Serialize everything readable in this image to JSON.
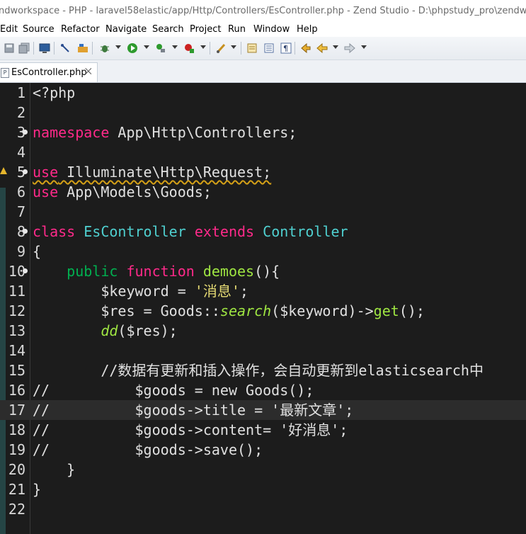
{
  "window": {
    "title": "ndworkspace - PHP - laravel58elastic/app/Http/Controllers/EsController.php - Zend Studio - D:\\phpstudy_pro\\zendworkspace"
  },
  "menu": [
    "Edit",
    "Source",
    "Refactor",
    "Navigate",
    "Search",
    "Project",
    "Run",
    "Window",
    "Help"
  ],
  "toolbar": {
    "icons": [
      "save-icon",
      "save-all-icon",
      "console-icon",
      "debug-toggle-icon",
      "build-icon",
      "bug-icon",
      "run-icon",
      "external-tools-icon",
      "coverage-icon",
      "brush-icon",
      "annotate-icon",
      "outline-icon",
      "paragraph-icon",
      "last-edit-icon",
      "back-icon",
      "forward-icon"
    ]
  },
  "editor_tab": {
    "label": "EsController.php",
    "close": "⨉"
  },
  "code_lines": [
    {
      "n": "1",
      "html": "&lt;?php"
    },
    {
      "n": "2",
      "html": ""
    },
    {
      "n": "3",
      "fold": true,
      "html": "<span class=\"k\">namespace</span> App\\Http\\Controllers;"
    },
    {
      "n": "4",
      "html": ""
    },
    {
      "n": "5",
      "fold": true,
      "warn": true,
      "html": "<span class=\"squig\"><span class=\"k\">use</span> Illuminate\\Http\\Request;</span>"
    },
    {
      "n": "6",
      "html": "<span class=\"k\">use</span> App\\Models\\Goods;"
    },
    {
      "n": "7",
      "html": ""
    },
    {
      "n": "8",
      "fold": true,
      "html": "<span class=\"k\">class</span> <span class=\"t\">EsController</span> <span class=\"k\">extends</span> <span class=\"t\">Controller</span>"
    },
    {
      "n": "9",
      "html": "{"
    },
    {
      "n": "10",
      "fold": true,
      "html": "    <span class=\"kg\">public</span> <span class=\"k\">function</span> <span class=\"fn\">demoes</span>(){"
    },
    {
      "n": "11",
      "html": "        $keyword = <span class=\"str\">'消息'</span>;"
    },
    {
      "n": "12",
      "html": "        $res = Goods::<span class=\"it\">search</span>($keyword)-&gt;<span class=\"fn\">get</span>();"
    },
    {
      "n": "13",
      "html": "        <span class=\"it\">dd</span>($res);"
    },
    {
      "n": "14",
      "html": ""
    },
    {
      "n": "15",
      "html": "        //数据有更新和插入操作，会自动更新到elasticsearch中"
    },
    {
      "n": "16",
      "html": "//          $goods = new Goods();"
    },
    {
      "n": "17",
      "current": true,
      "html": "//          $goods-&gt;title = '最新文章';"
    },
    {
      "n": "18",
      "html": "//          $goods-&gt;content= '好消息';"
    },
    {
      "n": "19",
      "html": "//          $goods-&gt;save();"
    },
    {
      "n": "20",
      "html": "    }"
    },
    {
      "n": "21",
      "html": "}"
    },
    {
      "n": "22",
      "html": ""
    }
  ]
}
